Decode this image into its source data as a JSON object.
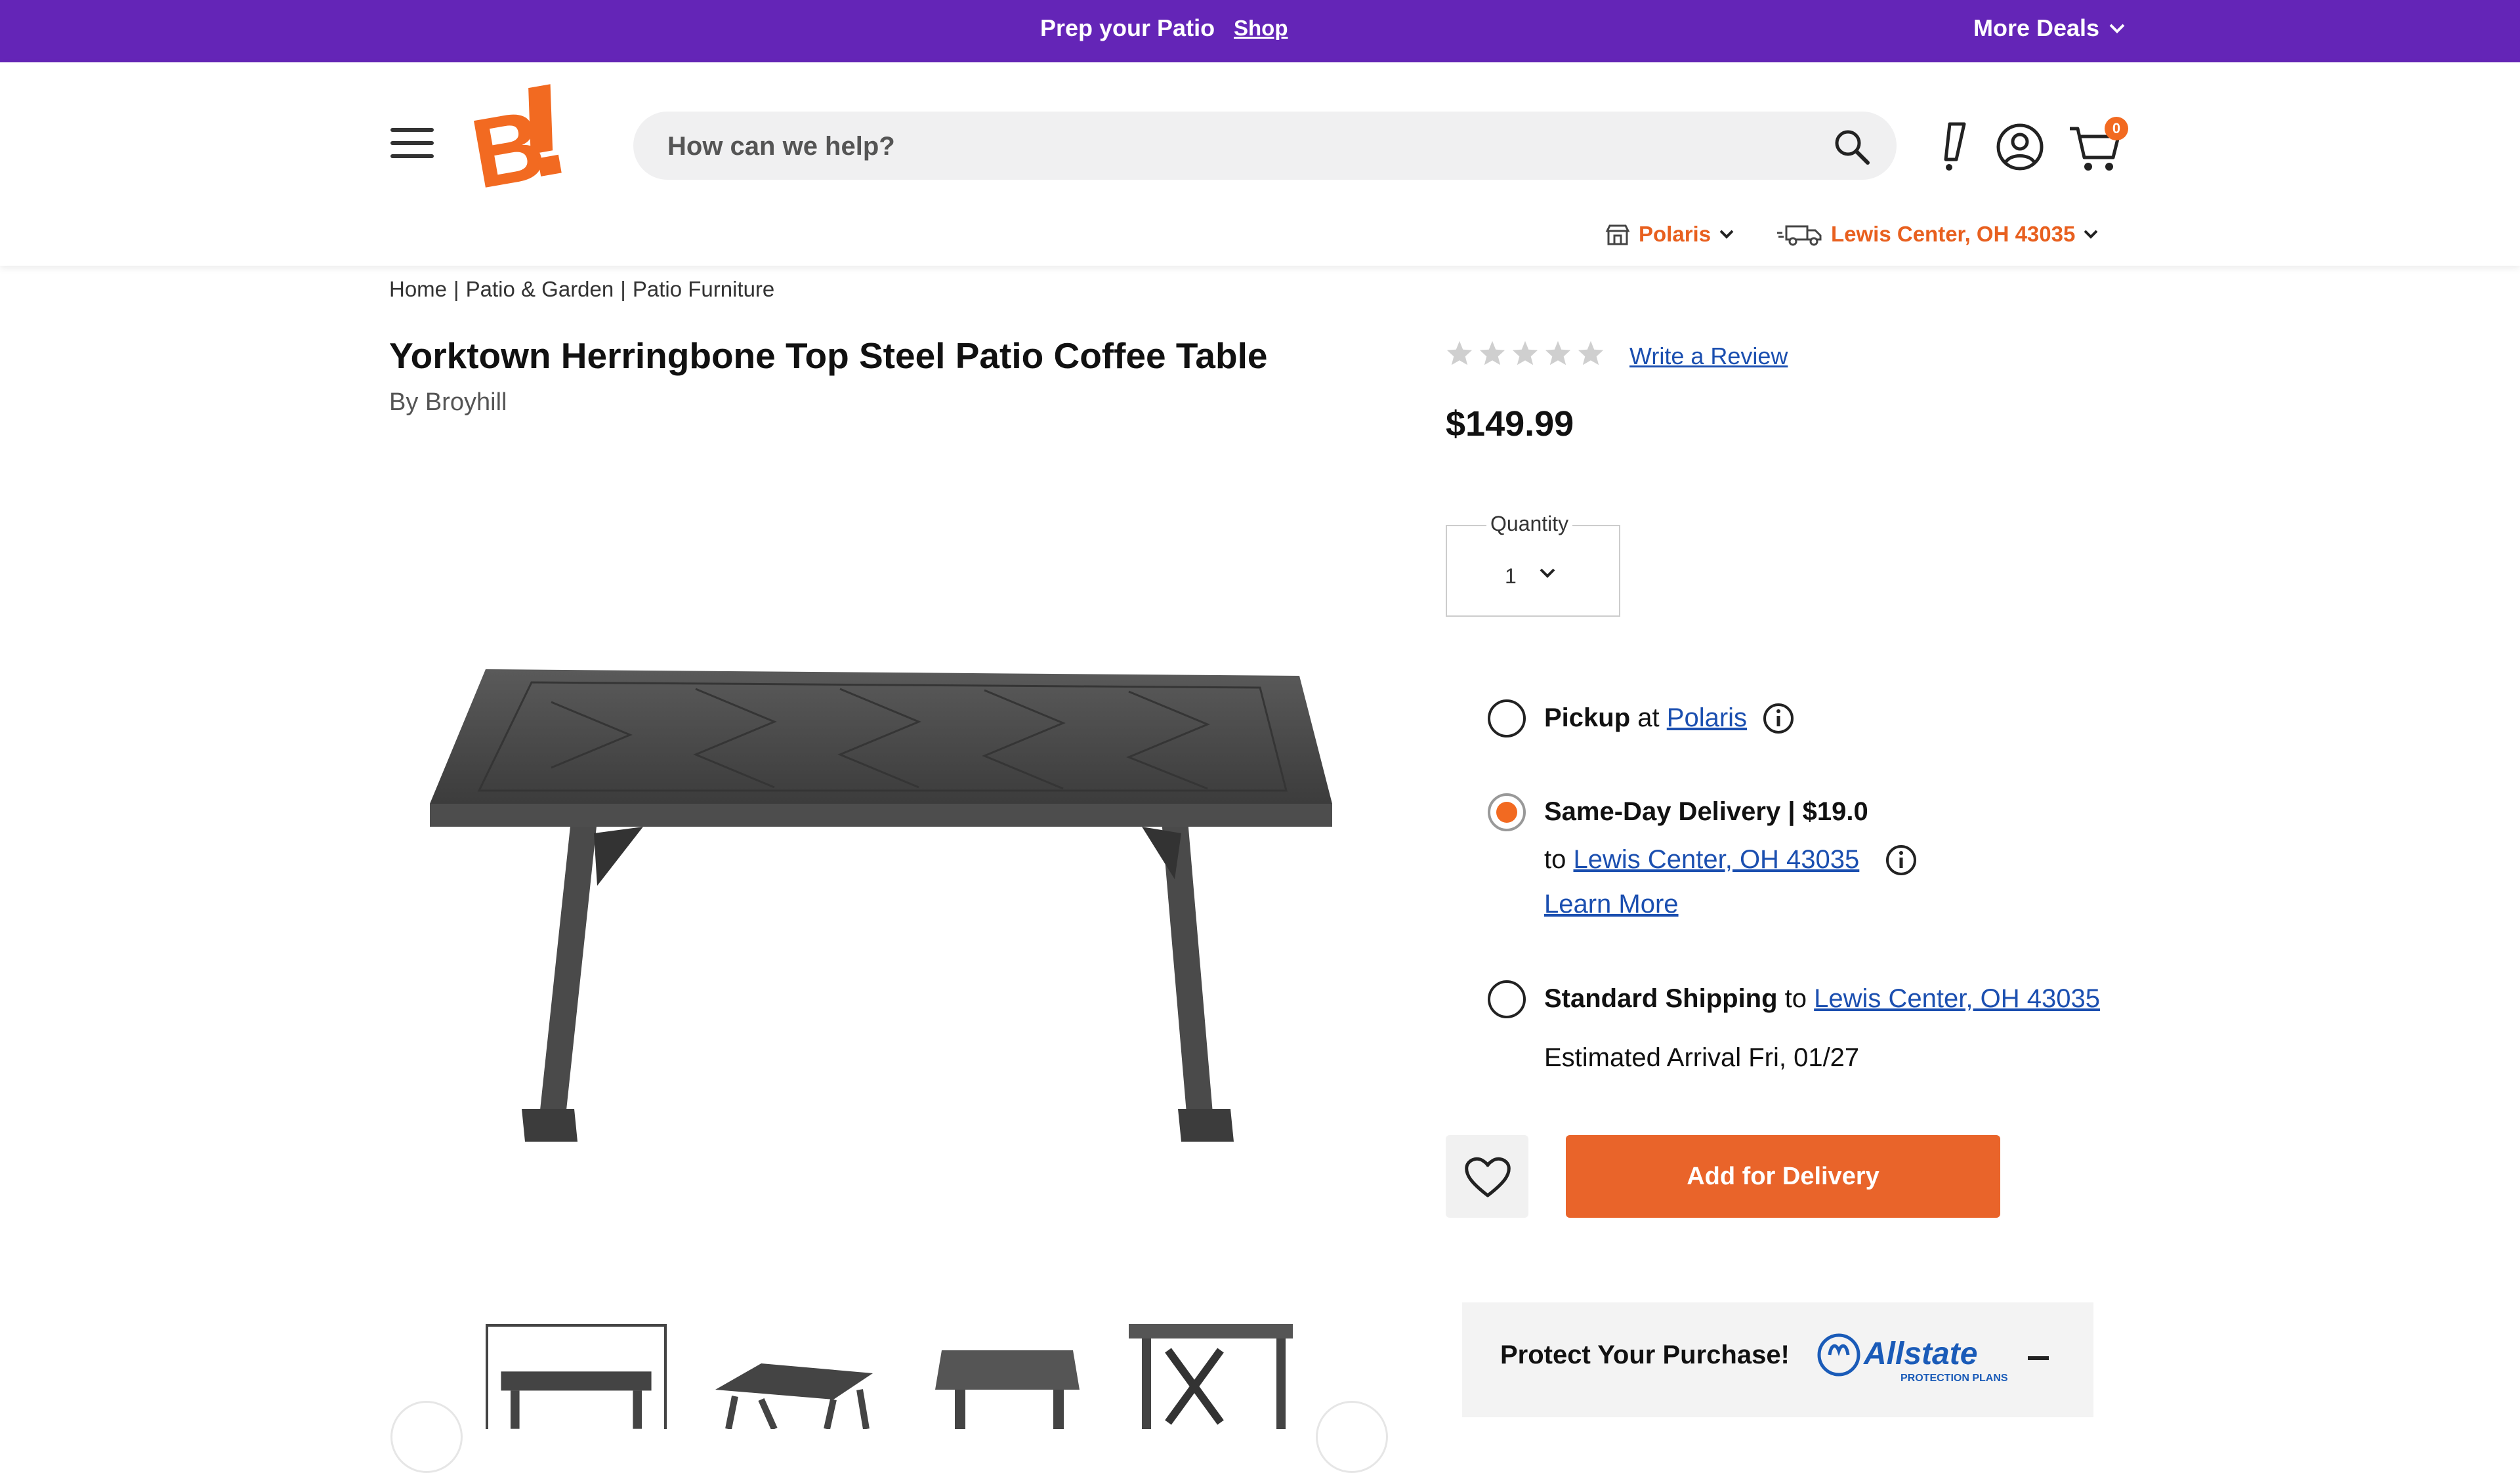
{
  "promo": {
    "text": "Prep your Patio",
    "link": "Shop",
    "more_deals": "More Deals"
  },
  "header": {
    "search_placeholder": "How can we help?",
    "store_name": "Polaris",
    "location": "Lewis Center, OH 43035",
    "cart_count": "0"
  },
  "breadcrumb": [
    "Home",
    "Patio & Garden",
    "Patio Furniture"
  ],
  "breadcrumb_sep": "|",
  "product": {
    "title": "Yorktown Herringbone Top Steel Patio Coffee Table",
    "brand": "By Broyhill",
    "rating": 0,
    "rating_max": 5,
    "write_review": "Write a Review",
    "price": "$149.99"
  },
  "quantity": {
    "label": "Quantity",
    "value": "1"
  },
  "fulfillment": {
    "pickup": {
      "label": "Pickup",
      "at": "at",
      "store": "Polaris",
      "selected": false
    },
    "same_day": {
      "label": "Same-Day Delivery | $19.0",
      "to": "to",
      "location": "Lewis Center, OH 43035",
      "learn_more": "Learn More",
      "selected": true
    },
    "standard": {
      "label": "Standard Shipping",
      "to": "to",
      "location": "Lewis Center, OH 43035",
      "arrival": "Estimated Arrival Fri, 01/27",
      "selected": false
    }
  },
  "actions": {
    "add_button": "Add for Delivery"
  },
  "protect": {
    "label": "Protect Your Purchase!",
    "brand": "Allstate",
    "brand_sub": "PROTECTION PLANS"
  },
  "colors": {
    "promo_bg": "#6425b7",
    "accent": "#f26a21",
    "link": "#1b4fb0",
    "button": "#e9642a"
  }
}
